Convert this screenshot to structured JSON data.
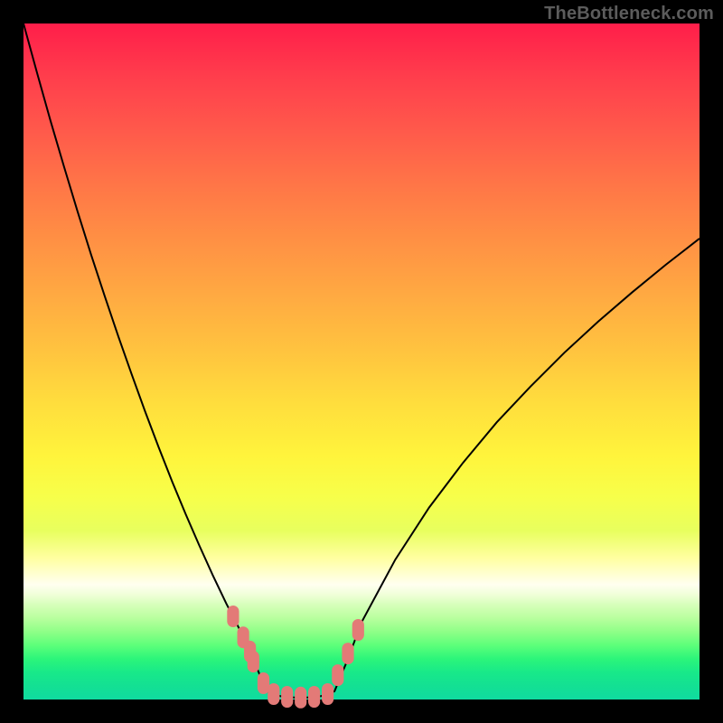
{
  "watermark": "TheBottleneck.com",
  "colors": {
    "background": "#000000",
    "curve": "#000000",
    "marker": "#e37a77",
    "gradient_top": "#ff1e4a",
    "gradient_bottom": "#10dba0"
  },
  "chart_data": {
    "type": "line",
    "title": "",
    "xlabel": "",
    "ylabel": "",
    "xlim": [
      0,
      100
    ],
    "ylim": [
      0,
      100
    ],
    "x": [
      0,
      2,
      4,
      6,
      8,
      10,
      12,
      14,
      16,
      18,
      20,
      22,
      24,
      26,
      28,
      30,
      32,
      33,
      34,
      35,
      36,
      38,
      40,
      42,
      44,
      46,
      48,
      50,
      55,
      60,
      65,
      70,
      75,
      80,
      85,
      90,
      95,
      100
    ],
    "values": [
      100.0,
      92.7,
      85.6,
      78.8,
      72.2,
      65.8,
      59.7,
      53.8,
      48.1,
      42.6,
      37.3,
      32.2,
      27.4,
      22.8,
      18.4,
      14.2,
      10.3,
      8.2,
      6.0,
      3.5,
      1.2,
      0.5,
      0.3,
      0.3,
      0.5,
      1.2,
      6.0,
      11.4,
      20.7,
      28.4,
      35.0,
      41.0,
      46.3,
      51.3,
      55.9,
      60.2,
      64.3,
      68.2
    ],
    "markers_x": [
      31.0,
      32.5,
      33.5,
      34.0,
      35.5,
      37.0,
      39.0,
      41.0,
      43.0,
      45.0,
      46.5,
      48.0,
      49.5
    ],
    "markers_y": [
      12.3,
      9.2,
      7.1,
      5.6,
      2.4,
      0.8,
      0.4,
      0.3,
      0.4,
      0.8,
      3.6,
      6.8,
      10.3
    ],
    "marker_size": 12
  }
}
